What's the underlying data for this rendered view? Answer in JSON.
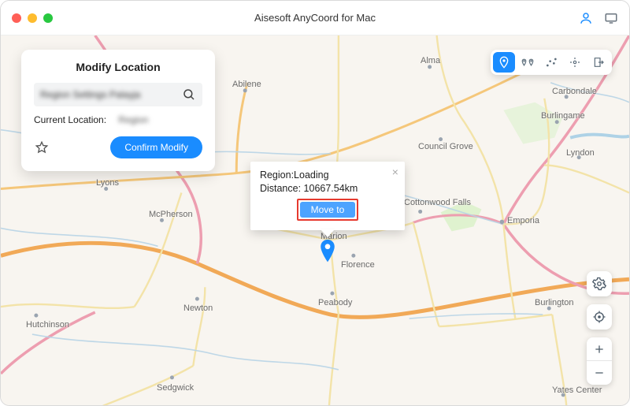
{
  "app": {
    "title": "Aisesoft AnyCoord for Mac"
  },
  "card": {
    "title": "Modify Location",
    "search_value": "Region Settings Palayja",
    "current_label": "Current Location:",
    "current_value": "Region",
    "confirm_label": "Confirm Modify"
  },
  "popup": {
    "region_label": "Region:",
    "region_value": "Loading",
    "distance_label": "Distance:",
    "distance_value": "10667.54km",
    "move_label": "Move to"
  },
  "map_labels": {
    "hutchinson": "Hutchinson",
    "mcpherson": "McPherson",
    "newton": "Newton",
    "sedgwick": "Sedgwick",
    "lyons": "Lyons",
    "abilene": "Abilene",
    "marion": "Marion",
    "peabody": "Peabody",
    "florence": "Florence",
    "cottonwoodfalls": "Cottonwood Falls",
    "councilgrove": "Council Grove",
    "alma": "Alma",
    "emporia": "Emporia",
    "burlington": "Burlington",
    "yatescenter": "Yates Center",
    "lyndon": "Lyndon",
    "burlingame": "Burlingame",
    "carbondale": "Carbondale"
  }
}
